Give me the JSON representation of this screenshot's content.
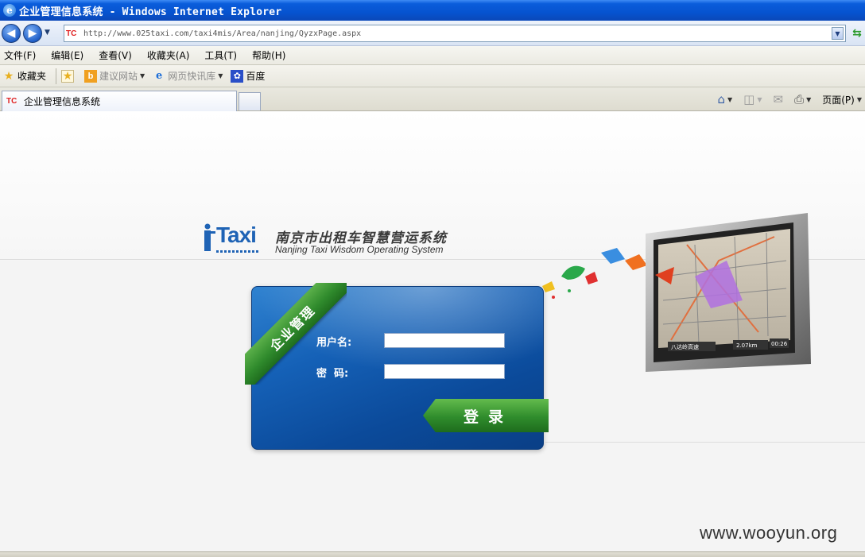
{
  "window": {
    "title": "企业管理信息系统 - Windows Internet Explorer"
  },
  "address_bar": {
    "url": "http://www.025taxi.com/taxi4mis/Area/nanjing/QyzxPage.aspx",
    "site_icon_text": "TC"
  },
  "menu": {
    "items": [
      "文件(F)",
      "编辑(E)",
      "查看(V)",
      "收藏夹(A)",
      "工具(T)",
      "帮助(H)"
    ]
  },
  "favorites_bar": {
    "favorites_label": "收藏夹",
    "suggested_sites": "建议网站",
    "web_slices": "网页快讯库",
    "baidu": "百度"
  },
  "tabs": {
    "active_title": "企业管理信息系统",
    "page_menu": "页面(P)"
  },
  "page": {
    "logo_text": "Taxi",
    "system_name_cn": "南京市出租车智慧营运系统",
    "system_name_en": "Nanjing Taxi Wisdom Operating System",
    "ribbon_text": "企业管理",
    "username_label": "用户名:",
    "password_label": "密  码:",
    "username_value": "",
    "password_value": "",
    "login_button": "登录",
    "gps_distance": "2.07km",
    "gps_time": "00:26",
    "gps_street": "八达岭高速"
  },
  "watermark": "www.wooyun.org",
  "colors": {
    "titlebar": "#0653d0",
    "panel_blue": "#1561b7",
    "ribbon_green": "#2f8a2c"
  }
}
